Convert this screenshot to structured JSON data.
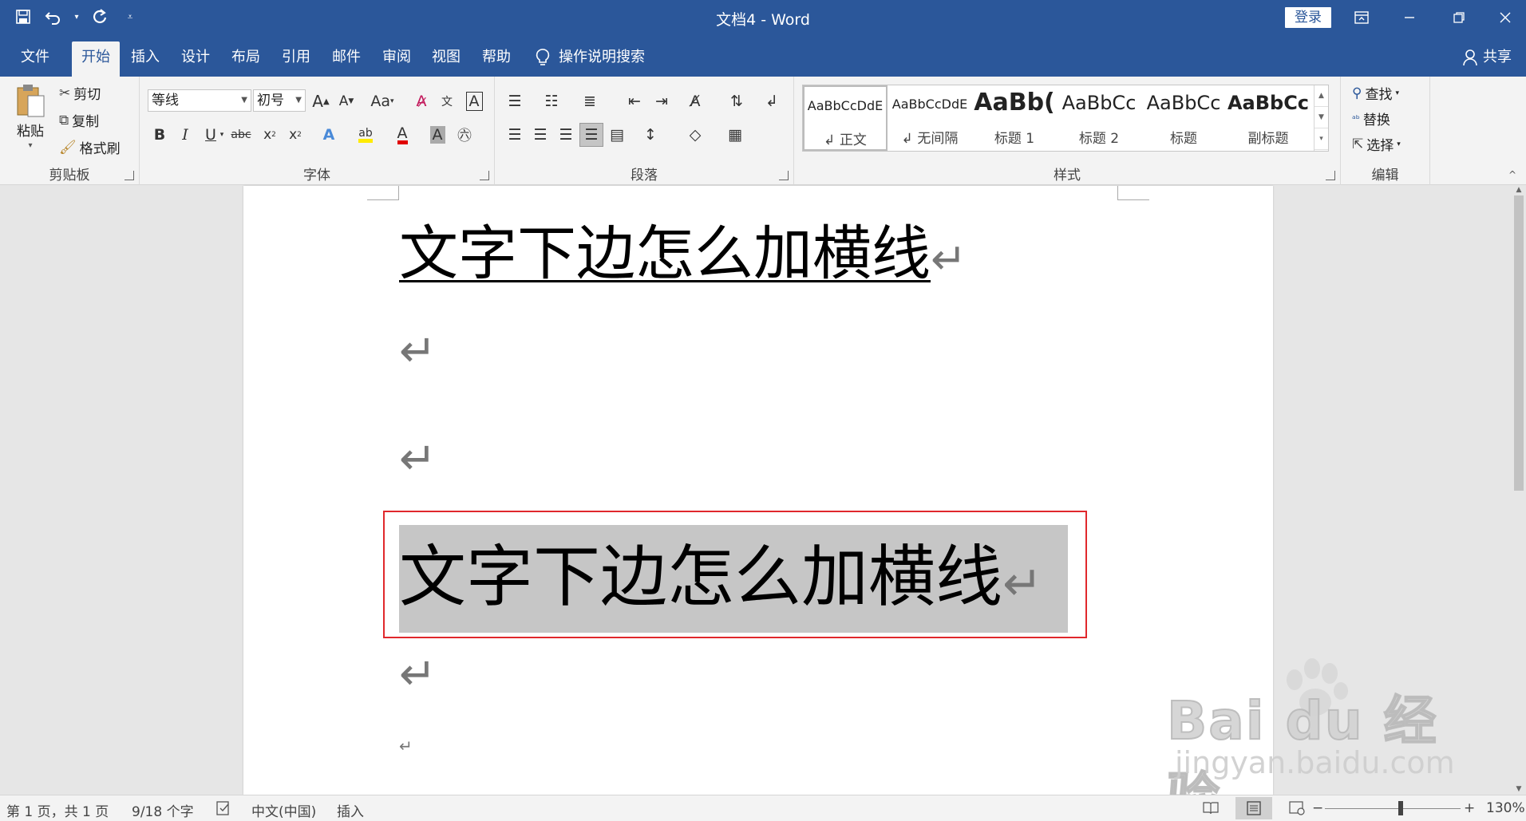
{
  "titlebar": {
    "doc_title": "文档4  -  Word",
    "login_label": "登录",
    "qat": {
      "save_icon": "save-icon",
      "undo_icon": "undo-icon",
      "redo_icon": "redo-icon",
      "customize_icon": "customize-qat-icon"
    },
    "window_controls": {
      "ribbon_display": "ribbon-display-icon",
      "minimize": "minimize-icon",
      "restore": "restore-icon",
      "close": "close-icon"
    }
  },
  "tabs": {
    "file": "文件",
    "home": "开始",
    "insert": "插入",
    "design": "设计",
    "layout": "布局",
    "references": "引用",
    "mailings": "邮件",
    "review": "审阅",
    "view": "视图",
    "help": "帮助",
    "tell_me": "操作说明搜索",
    "share": "共享"
  },
  "ribbon": {
    "clipboard": {
      "label": "剪贴板",
      "paste": "粘贴",
      "cut": "剪切",
      "copy": "复制",
      "format_painter": "格式刷"
    },
    "font": {
      "label": "字体",
      "font_name": "等线",
      "font_size": "初号",
      "change_case": "Aa"
    },
    "paragraph": {
      "label": "段落"
    },
    "styles": {
      "label": "样式",
      "items": [
        {
          "sample": "AaBbCcDdE",
          "name": "↲ 正文"
        },
        {
          "sample": "AaBbCcDdE",
          "name": "↲ 无间隔"
        },
        {
          "sample": "AaBb(",
          "name": "标题 1"
        },
        {
          "sample": "AaBbCc",
          "name": "标题 2"
        },
        {
          "sample": "AaBbCc",
          "name": "标题"
        },
        {
          "sample": "AaBbCc",
          "name": "副标题"
        }
      ]
    },
    "editing": {
      "label": "编辑",
      "find": "查找",
      "replace": "替换",
      "select": "选择"
    }
  },
  "document": {
    "line1": "文字下边怎么加横线",
    "line2": "文字下边怎么加横线",
    "para_mark": "↵"
  },
  "statusbar": {
    "page": "第 1 页，共 1 页",
    "words": "9/18 个字",
    "language": "中文(中国)",
    "mode": "插入",
    "zoom": "130%",
    "zoom_minus": "−",
    "zoom_plus": "+"
  },
  "watermark": {
    "logo": "Bai du 经验",
    "url": "jingyan.baidu.com"
  }
}
